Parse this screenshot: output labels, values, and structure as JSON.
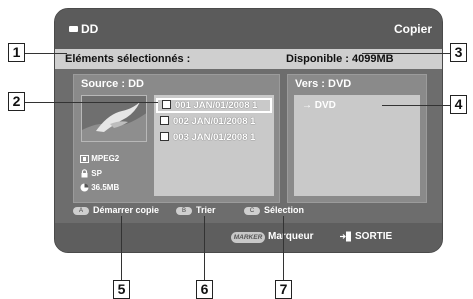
{
  "screen": {
    "title": "DD",
    "mode": "Copier",
    "selected_label": "Eléments sélectionnés :",
    "available_label": "Disponible : 4099MB",
    "source": {
      "title": "Source : DD",
      "meta": [
        {
          "icon": "film-icon",
          "text": "MPEG2"
        },
        {
          "icon": "lock-icon",
          "text": "SP"
        },
        {
          "icon": "pie-icon",
          "text": "36.5MB"
        }
      ],
      "items": [
        {
          "label": "001 JAN/01/2008 1",
          "selected": true
        },
        {
          "label": "002 JAN/01/2008 1",
          "selected": false
        },
        {
          "label": "003 JAN/01/2008 1",
          "selected": false
        }
      ]
    },
    "destination": {
      "title": "Vers : DVD",
      "items": [
        "DVD"
      ]
    },
    "footer": {
      "buttons": [
        {
          "key": "A",
          "label": "Démarrer copie"
        },
        {
          "key": "B",
          "label": "Trier"
        },
        {
          "key": "C",
          "label": "Sélection"
        }
      ],
      "marker_key": "MARKER",
      "marker_label": "Marqueur",
      "exit_label": "SORTIE"
    }
  },
  "callouts": [
    "1",
    "2",
    "3",
    "4",
    "5",
    "6",
    "7"
  ]
}
